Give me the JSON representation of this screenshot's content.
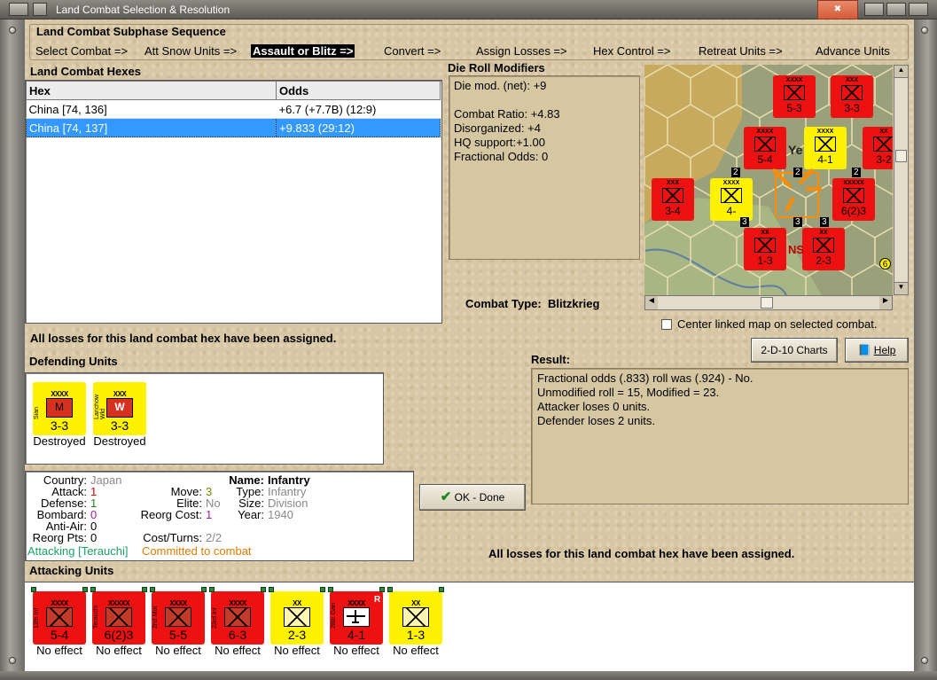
{
  "window": {
    "title": "Land Combat Selection & Resolution"
  },
  "subphase": {
    "title": "Land Combat Subphase Sequence",
    "steps": [
      "Select Combat =>",
      "Att Snow Units =>",
      "Assault or Blitz =>",
      "Convert =>",
      "Assign Losses =>",
      "Hex Control =>",
      "Retreat Units =>",
      "Advance Units"
    ],
    "selected_index": 2
  },
  "hexes": {
    "title": "Land Combat Hexes",
    "col_hex": "Hex",
    "col_odds": "Odds",
    "rows": [
      {
        "hex": "China [74, 136]",
        "odds": "+6.7 (+7.7B) (12:9)"
      },
      {
        "hex": "China [74, 137]",
        "odds": "+9.833 (29:12)"
      }
    ],
    "selected_row": 1
  },
  "modifiers": {
    "title": "Die Roll Modifiers",
    "net": "Die mod. (net): +9",
    "ratio": "Combat Ratio: +4.83",
    "disorg": "Disorganized: +4",
    "hq": "HQ support:+1.00",
    "frac": "Fractional Odds: 0"
  },
  "combat_type": {
    "label": "Combat Type:",
    "value": "Blitzkrieg"
  },
  "center_map": "Center linked map on selected combat.",
  "losses_msg": "All losses for this land combat hex have been assigned.",
  "buttons": {
    "charts": "2-D-10 Charts",
    "help": "Help",
    "ok": "OK - Done"
  },
  "result": {
    "title": "Result:",
    "lines": [
      "Fractional odds (.833) roll was (.924)  - No.",
      "Unmodified roll = 15, Modified = 23.",
      "Attacker loses 0 units.",
      "Defender loses 2 units."
    ]
  },
  "defending": {
    "title": "Defending Units",
    "units": [
      {
        "size": "XXXX",
        "name": "Sian",
        "sym": "M",
        "str": "3-3",
        "status": "Destroyed"
      },
      {
        "size": "XXX",
        "name": "Lanchow Wld",
        "sym": "W",
        "str": "3-3",
        "status": "Destroyed"
      }
    ]
  },
  "info": {
    "country_k": "Country:",
    "country_v": "Japan",
    "attack_k": "Attack:",
    "attack_v": "1",
    "defense_k": "Defense:",
    "defense_v": "1",
    "bombard_k": "Bombard:",
    "bombard_v": "0",
    "aa_k": "Anti-Air:",
    "aa_v": "0",
    "reorg_k": "Reorg Pts:",
    "reorg_v": "0",
    "move_k": "Move:",
    "move_v": "3",
    "elite_k": "Elite:",
    "elite_v": "No",
    "rcost_k": "Reorg Cost:",
    "rcost_v": "1",
    "turns_k": "Cost/Turns:",
    "turns_v": "2/2",
    "name_k": "Name:",
    "name_v": "Infantry",
    "type_k": "Type:",
    "type_v": "Infantry",
    "size_k": "Size:",
    "size_v": "Division",
    "year_k": "Year:",
    "year_v": "1940",
    "attacking_lbl": "Attacking [Terauchi]",
    "committed_lbl": "Committed to combat"
  },
  "attacking": {
    "title": "Attacking Units",
    "units": [
      {
        "size": "XXXX",
        "name": "13th Inf",
        "str": "5-4",
        "status": "No effect",
        "style": "red"
      },
      {
        "size": "XXXXX",
        "name": "Terauchi",
        "str": "6(2)3",
        "status": "No effect",
        "style": "red"
      },
      {
        "size": "XXXX",
        "name": "2nd Mot",
        "str": "5-5",
        "status": "No effect",
        "style": "red"
      },
      {
        "size": "XXXX",
        "name": "23rd Inf",
        "str": "6-3",
        "status": "No effect",
        "style": "red"
      },
      {
        "size": "XX",
        "name": "",
        "str": "2-3",
        "status": "No effect",
        "style": "yel"
      },
      {
        "size": "XXXX",
        "name": "28th Garr",
        "str": "4-1",
        "status": "No effect",
        "style": "air",
        "badge": "R"
      },
      {
        "size": "XX",
        "name": "",
        "str": "1-3",
        "status": "No effect",
        "style": "yel"
      }
    ]
  },
  "map_counters": [
    {
      "str": "5-3",
      "sz": "XXXX"
    },
    {
      "str": "3-3",
      "sz": "XXX"
    },
    {
      "str": "5-4",
      "sz": "XXXX"
    },
    {
      "str": "4-1",
      "sz": "XXXX"
    },
    {
      "str": "3-2",
      "sz": "XX"
    },
    {
      "str": "3-4",
      "sz": "XXX"
    },
    {
      "str": "4-",
      "sz": "XXXX"
    },
    {
      "str": "6(2)3",
      "sz": "XXXXX"
    },
    {
      "str": "1-3",
      "sz": "XX"
    },
    {
      "str": "2-3",
      "sz": "XX"
    }
  ],
  "map_text": {
    "ye": "Ye",
    "ns": "NS",
    "n1": "2",
    "n2": "2",
    "n3": "2",
    "n4": "3",
    "n5": "3",
    "n6": "3",
    "n7": "6"
  },
  "colors": {
    "unit_red": "#ee1111",
    "unit_yellow": "#fff200",
    "select_blue": "#3399ff",
    "green_attack": "#1aa06a",
    "orange_commit": "#e07b00"
  }
}
